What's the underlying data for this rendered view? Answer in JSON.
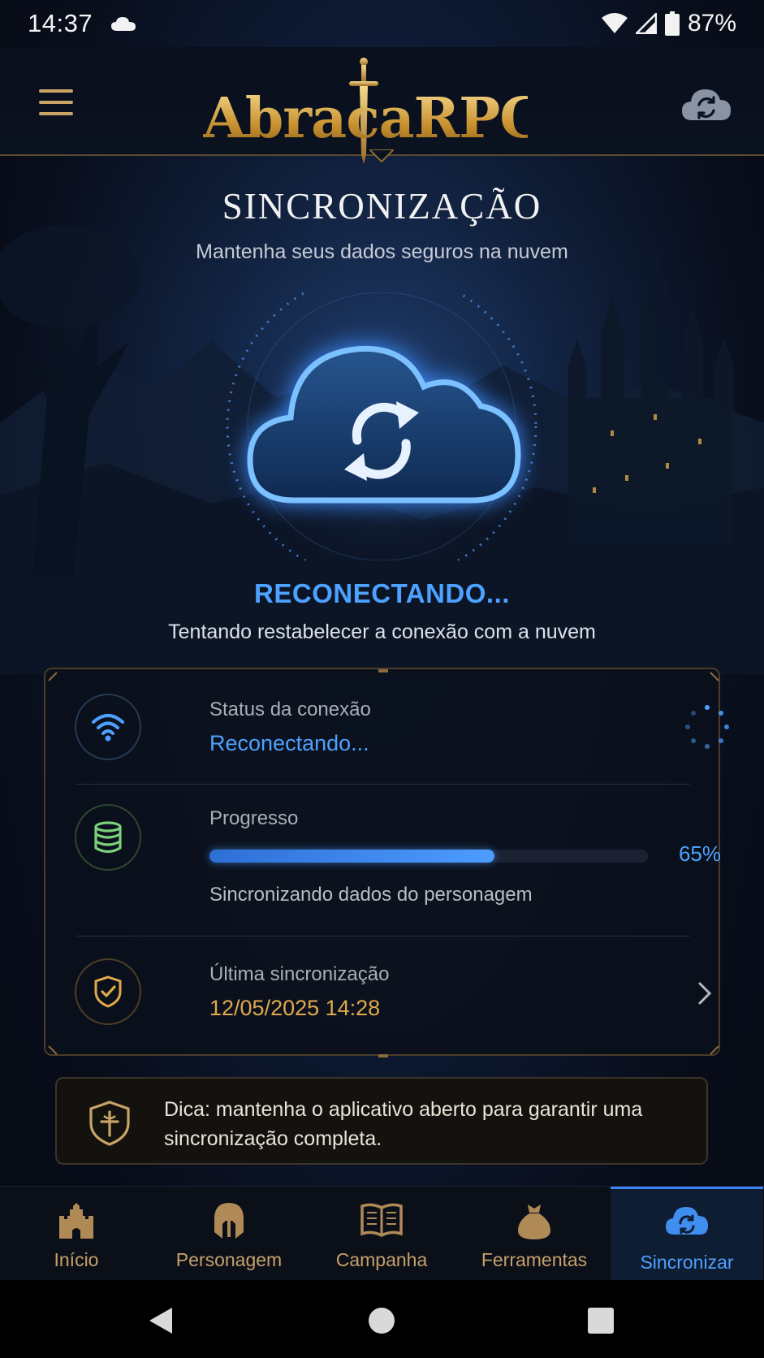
{
  "status_bar": {
    "time": "14:37",
    "battery": "87%",
    "icons": [
      "cloud-icon",
      "wifi-icon",
      "signal-icon",
      "battery-icon"
    ]
  },
  "header": {
    "logo_text": "AbracaRPG",
    "menu_icon": "menu-icon",
    "sync_icon": "cloud-sync-icon"
  },
  "page": {
    "title": "SINCRONIZAÇÃO",
    "subtitle": "Mantenha seus dados seguros na nuvem"
  },
  "hero": {
    "icon": "cloud-sync-icon",
    "status_title": "RECONECTANDO...",
    "status_desc": "Tentando restabelecer a conexão com a nuvem"
  },
  "card": {
    "connection": {
      "label": "Status da conexão",
      "value": "Reconectando...",
      "icon": "wifi-icon"
    },
    "progress": {
      "label": "Progresso",
      "percent_text": "65%",
      "fraction": 0.65,
      "desc": "Sincronizando dados do personagem",
      "icon": "database-icon"
    },
    "last_sync": {
      "label": "Última sincronização",
      "value": "12/05/2025 14:28",
      "icon": "shield-check-icon"
    }
  },
  "tip": {
    "text": "Dica: mantenha o aplicativo aberto para garantir uma sincronização completa.",
    "icon": "shield-crest-icon"
  },
  "nav": {
    "items": [
      {
        "label": "Início",
        "icon": "castle-icon"
      },
      {
        "label": "Personagem",
        "icon": "helmet-icon"
      },
      {
        "label": "Campanha",
        "icon": "book-icon"
      },
      {
        "label": "Ferramentas",
        "icon": "bag-icon"
      },
      {
        "label": "Sincronizar",
        "icon": "cloud-sync-icon"
      }
    ],
    "active_index": 4
  },
  "colors": {
    "accent_blue": "#4da1ff",
    "gold": "#e0a94b",
    "nav_gold": "#c5a06a",
    "background": "#070b14"
  }
}
